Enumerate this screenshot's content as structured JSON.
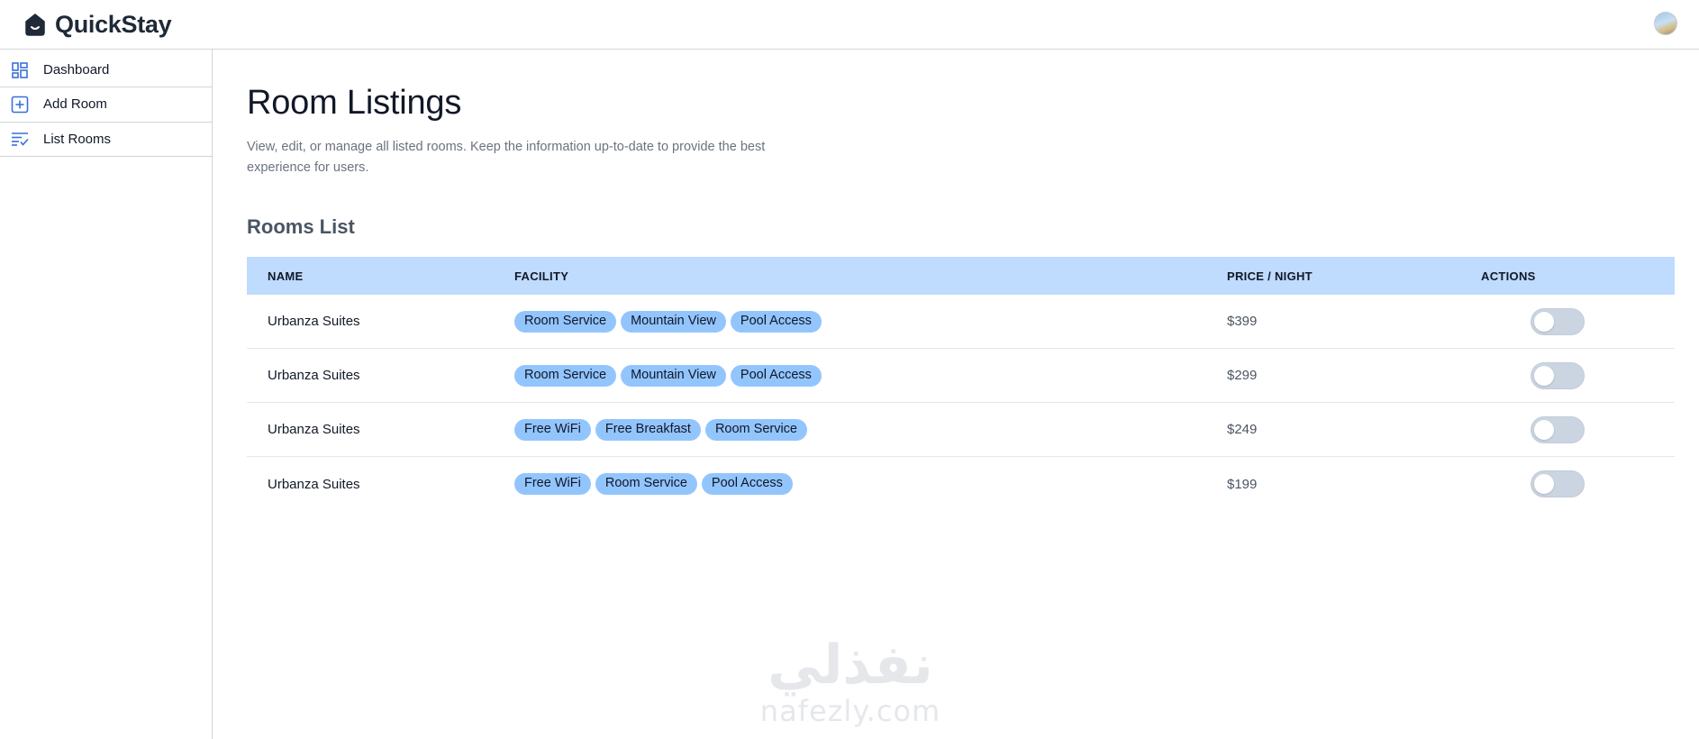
{
  "app": {
    "name": "QuickStay"
  },
  "sidebar": {
    "items": [
      {
        "label": "Dashboard",
        "icon": "dashboard-icon"
      },
      {
        "label": "Add Room",
        "icon": "add-box-icon"
      },
      {
        "label": "List Rooms",
        "icon": "list-rooms-icon"
      }
    ]
  },
  "main": {
    "title": "Room Listings",
    "description": "View, edit, or manage all listed rooms. Keep the information up-to-date to provide the best experience for users.",
    "section_title": "Rooms List"
  },
  "table": {
    "headers": [
      "NAME",
      "FACILITY",
      "PRICE / NIGHT",
      "ACTIONS"
    ],
    "rows": [
      {
        "name": "Urbanza Suites",
        "facilities": [
          "Room Service",
          "Mountain View",
          "Pool Access"
        ],
        "price": "$399",
        "available": false
      },
      {
        "name": "Urbanza Suites",
        "facilities": [
          "Room Service",
          "Mountain View",
          "Pool Access"
        ],
        "price": "$299",
        "available": false
      },
      {
        "name": "Urbanza Suites",
        "facilities": [
          "Free WiFi",
          "Free Breakfast",
          "Room Service"
        ],
        "price": "$249",
        "available": false
      },
      {
        "name": "Urbanza Suites",
        "facilities": [
          "Free WiFi",
          "Room Service",
          "Pool Access"
        ],
        "price": "$199",
        "available": false
      }
    ]
  },
  "watermark": {
    "arabic": "نفذلي",
    "latin": "nafezly.com"
  },
  "colors": {
    "header_bg": "#bfdbfe",
    "pill_bg": "#93c5fd",
    "icon_blue": "#3b6fd8",
    "toggle_off": "#cbd5e1"
  }
}
